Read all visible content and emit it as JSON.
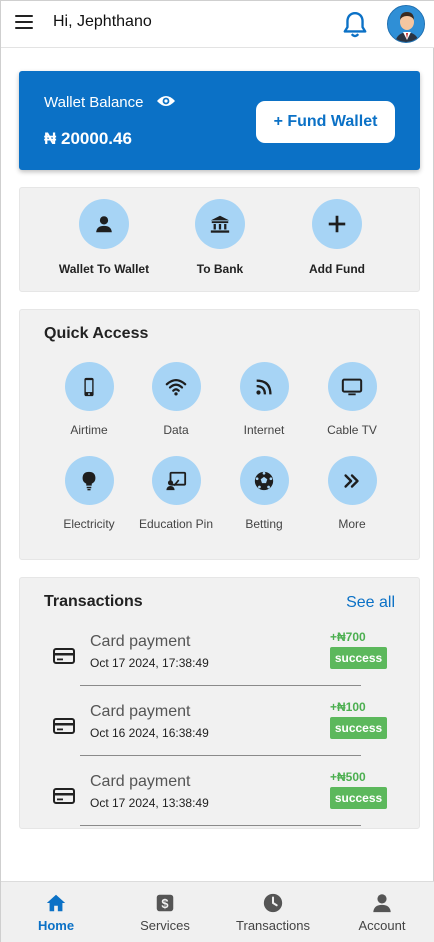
{
  "header": {
    "greeting": "Hi, Jephthano",
    "menu_icon": "hamburger-menu-icon",
    "notification_icon": "bell-icon",
    "avatar_icon": "user-avatar"
  },
  "wallet": {
    "title": "Wallet Balance",
    "visibility_icon": "eye-icon",
    "amount": "₦ 20000.46",
    "fund_button": "+ Fund Wallet",
    "color": "#0b71c6"
  },
  "actions": [
    {
      "label": "Wallet To Wallet",
      "icon": "person-icon"
    },
    {
      "label": "To Bank",
      "icon": "bank-icon"
    },
    {
      "label": "Add Fund",
      "icon": "plus-icon"
    }
  ],
  "quick_access": {
    "title": "Quick Access",
    "items": [
      {
        "label": "Airtime",
        "icon": "phone-icon"
      },
      {
        "label": "Data",
        "icon": "wifi-icon"
      },
      {
        "label": "Internet",
        "icon": "rss-icon"
      },
      {
        "label": "Cable TV",
        "icon": "tv-icon"
      },
      {
        "label": "Electricity",
        "icon": "bulb-icon"
      },
      {
        "label": "Education Pin",
        "icon": "education-icon"
      },
      {
        "label": "Betting",
        "icon": "soccer-ball-icon"
      },
      {
        "label": "More",
        "icon": "double-chevron-right-icon"
      }
    ]
  },
  "transactions": {
    "title": "Transactions",
    "see_all": "See all",
    "items": [
      {
        "title": "Card payment",
        "date": "Oct 17 2024, 17:38:49",
        "amount": "+₦700",
        "status": "success",
        "icon": "card-icon"
      },
      {
        "title": "Card payment",
        "date": "Oct 16 2024, 16:38:49",
        "amount": "+₦100",
        "status": "success",
        "icon": "card-icon"
      },
      {
        "title": "Card payment",
        "date": "Oct 17 2024, 13:38:49",
        "amount": "+₦500",
        "status": "success",
        "icon": "card-icon"
      }
    ]
  },
  "bottom_nav": [
    {
      "label": "Home",
      "icon": "home-icon",
      "active": true
    },
    {
      "label": "Services",
      "icon": "services-icon",
      "active": false
    },
    {
      "label": "Transactions",
      "icon": "clock-icon",
      "active": false
    },
    {
      "label": "Account",
      "icon": "account-icon",
      "active": false
    }
  ],
  "colors": {
    "primary": "#0b71c6",
    "icon_circle": "#a7d4f5",
    "success": "#5cb85c"
  }
}
